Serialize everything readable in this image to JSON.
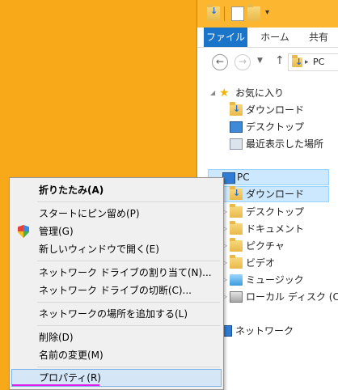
{
  "colors": {
    "desktop_bg": "#f7a919",
    "file_tab_bg": "#1a74c9",
    "menu_highlight_bg": "#d5e6f7",
    "selection_bg": "#cce8ff",
    "annotation_underline": "#e019e8"
  },
  "explorer": {
    "quick_access_icons": [
      "properties-icon",
      "new-folder-icon",
      "customize-arrow-icon"
    ],
    "ribbon_tabs": [
      {
        "label": "ファイル",
        "active": true
      },
      {
        "label": "ホーム",
        "active": false
      },
      {
        "label": "共有",
        "active": false
      }
    ],
    "address": {
      "path": "PC"
    },
    "nav_pane": {
      "favorites": {
        "label": "お気に入り",
        "items": [
          "ダウンロード",
          "デスクトップ",
          "最近表示した場所"
        ]
      },
      "pc": {
        "label": "PC",
        "items": [
          "ダウンロード",
          "デスクトップ",
          "ドキュメント",
          "ピクチャ",
          "ビデオ",
          "ミュージック",
          "ローカル ディスク (C:)"
        ]
      },
      "network": {
        "label": "ネットワーク"
      }
    }
  },
  "context_menu": {
    "items": [
      {
        "label": "折りたたみ(A)",
        "bold": true
      },
      {
        "label": "スタートにピン留め(P)"
      },
      {
        "label": "管理(G)",
        "icon": "uac-shield-icon"
      },
      {
        "label": "新しいウィンドウで開く(E)"
      },
      {
        "label": "ネットワーク ドライブの割り当て(N)..."
      },
      {
        "label": "ネットワーク ドライブの切断(C)..."
      },
      {
        "label": "ネットワークの場所を追加する(L)"
      },
      {
        "label": "削除(D)"
      },
      {
        "label": "名前の変更(M)"
      },
      {
        "label": "プロパティ(R)",
        "highlighted": true
      }
    ]
  }
}
